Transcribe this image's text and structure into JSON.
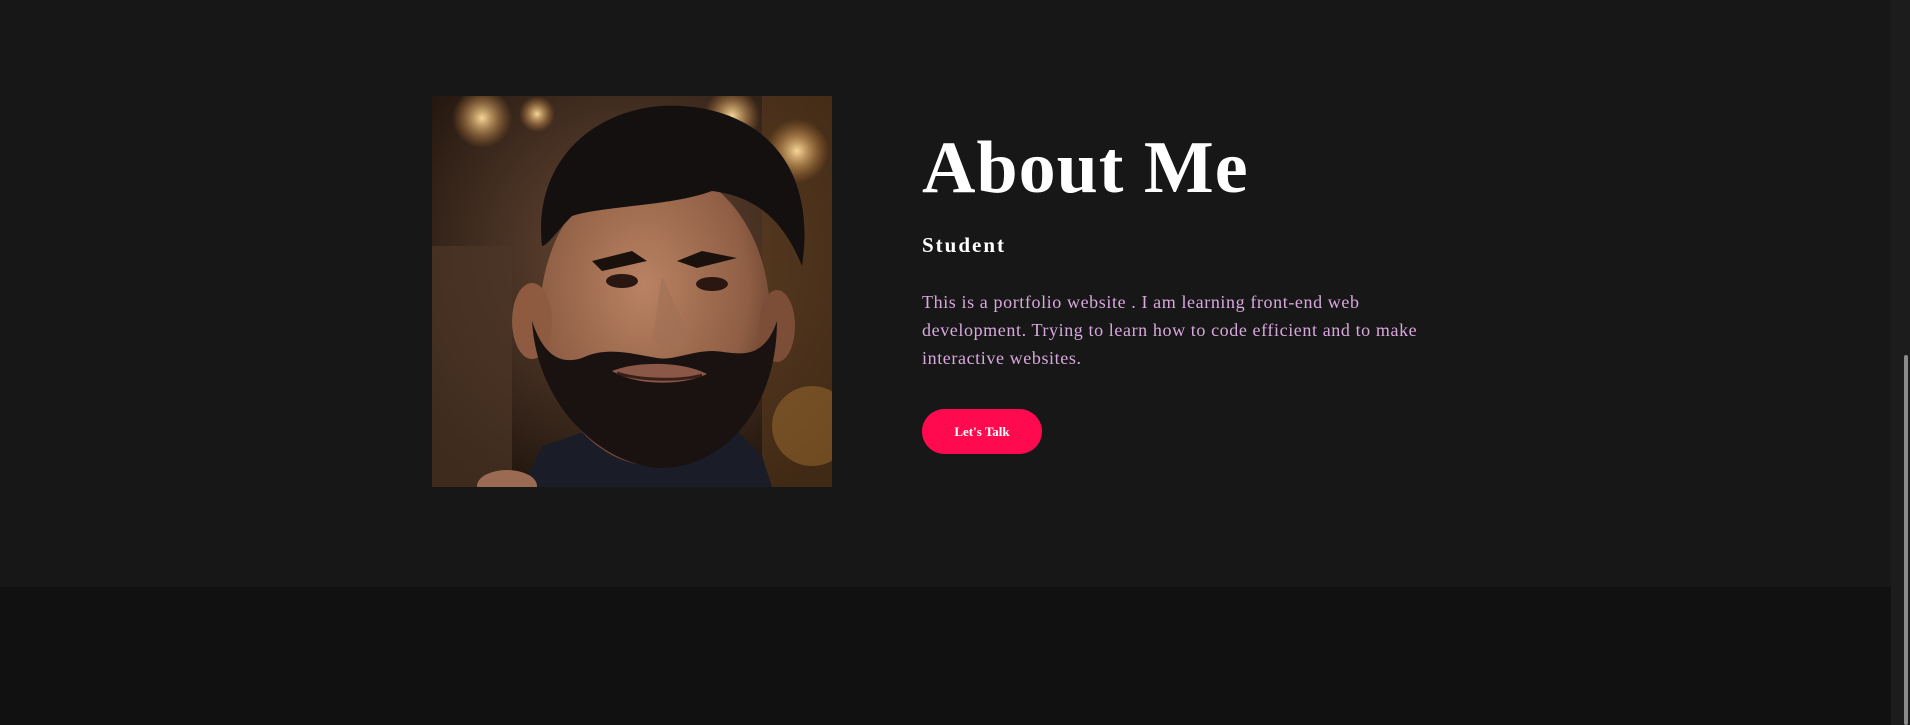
{
  "about": {
    "title": "About Me",
    "subtitle": "Student",
    "description": "This is a portfolio website . I am learning front-end web development. Trying to learn how to code efficient and to make interactive websites.",
    "cta_label": "Let's Talk"
  },
  "colors": {
    "section_background": "#171717",
    "page_background": "#111111",
    "title": "#ffffff",
    "description": "#d9a8dd",
    "accent": "#ff0a4f"
  }
}
